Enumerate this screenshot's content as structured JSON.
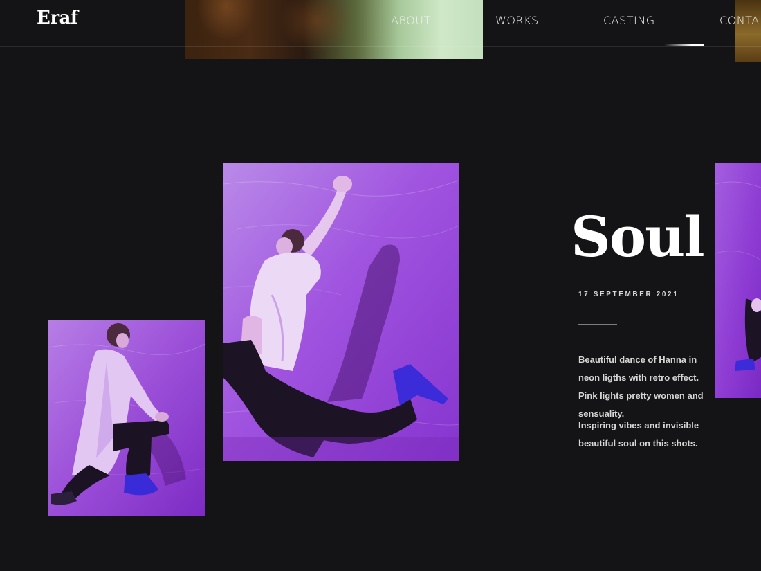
{
  "brand": {
    "logo": "Eraf"
  },
  "nav": {
    "items": [
      {
        "label": "ABOUT"
      },
      {
        "label": "WORKS"
      },
      {
        "label": "CASTING"
      },
      {
        "label": "CONTA"
      }
    ]
  },
  "article": {
    "title": "Soul D",
    "date": "17 SEPTEMBER 2021",
    "paragraphs": [
      "Beautiful dance of Hanna in neon ligths with retro effect. Pink lights pretty women and sensuality.",
      "Inspiring vibes and invisible beautiful soul on this shots."
    ]
  },
  "colors": {
    "background": "#141316",
    "accent_purple": "#9b3fd6",
    "text": "#ffffff",
    "muted_text": "#d6d6d6"
  }
}
